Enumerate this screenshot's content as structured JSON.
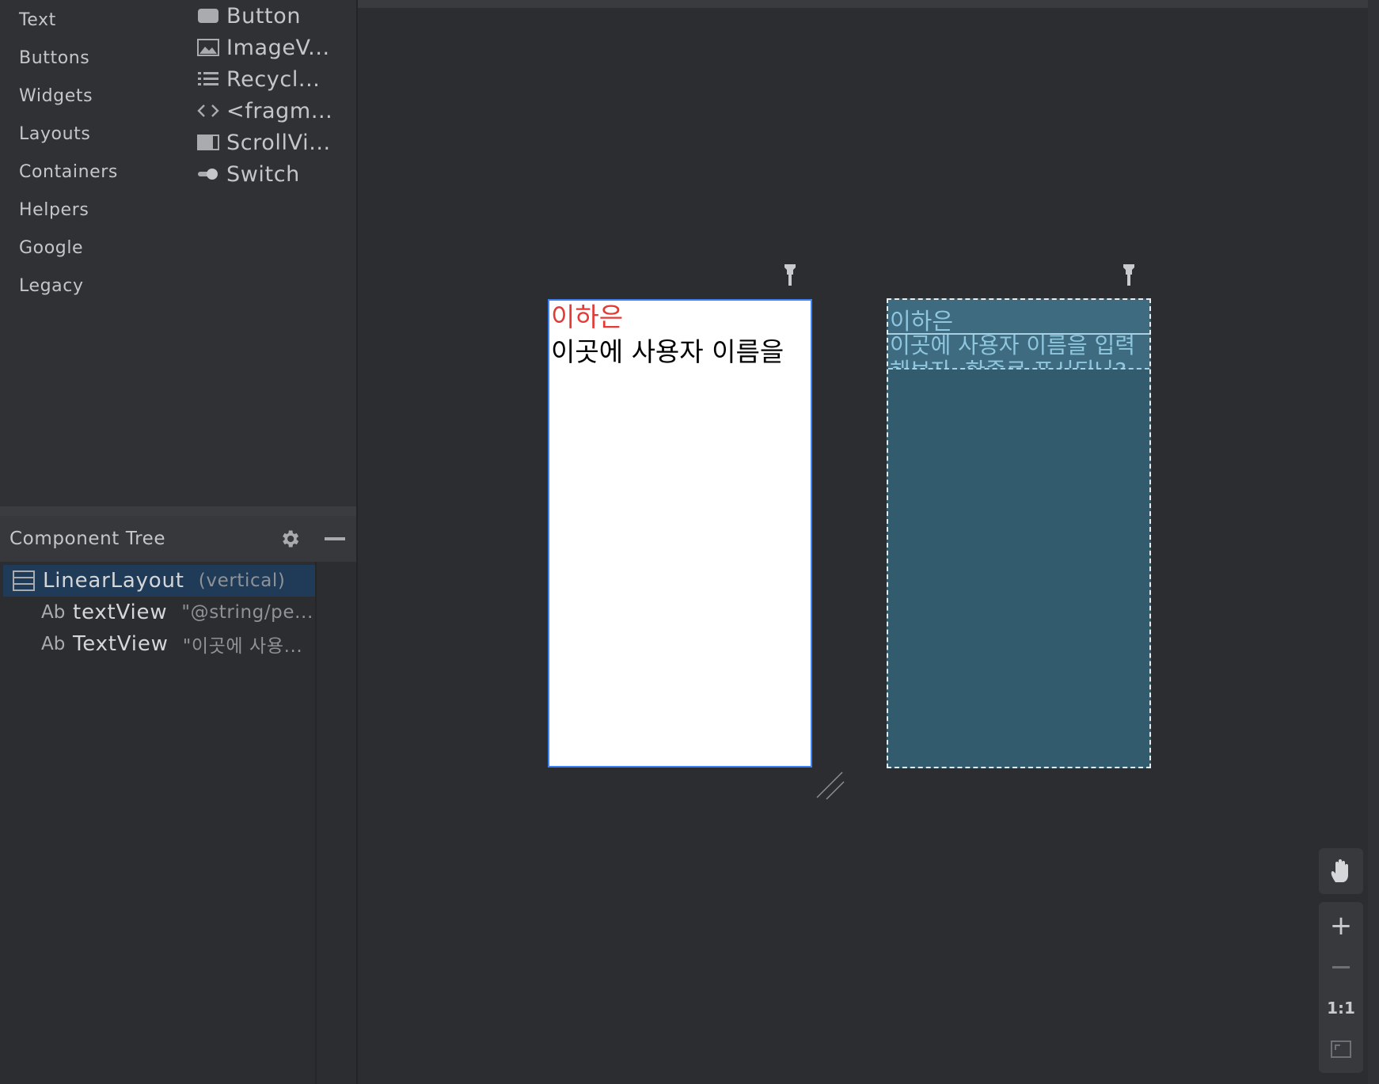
{
  "palette": {
    "categories": [
      "Text",
      "Buttons",
      "Widgets",
      "Layouts",
      "Containers",
      "Helpers",
      "Google",
      "Legacy"
    ],
    "widgets": [
      {
        "label": "Button",
        "icon": "button-icon"
      },
      {
        "label": "ImageV...",
        "icon": "image-icon"
      },
      {
        "label": "Recycl...",
        "icon": "list-icon"
      },
      {
        "label": "<fragm...",
        "icon": "code-icon"
      },
      {
        "label": "ScrollVi...",
        "icon": "scroll-icon"
      },
      {
        "label": "Switch",
        "icon": "switch-icon"
      }
    ]
  },
  "component_tree": {
    "title": "Component Tree",
    "rows": [
      {
        "name": "LinearLayout",
        "meta": "(vertical)",
        "icon": "linear-layout-icon"
      },
      {
        "prefix": "Ab",
        "name": "textView",
        "meta": "\"@string/pe..."
      },
      {
        "prefix": "Ab",
        "name": "TextView",
        "meta": "\"이곳에 사용..."
      }
    ]
  },
  "design": {
    "text1": "이하은",
    "text2": "이곳에 사용자 이름을",
    "text1_color": "#e53935"
  },
  "blueprint": {
    "text1": "이하은",
    "text2": "이곳에 사용자 이름을 입력해보자. 한줄로 표시되나?"
  },
  "zoom": {
    "in": "+",
    "one_to_one": "1:1"
  },
  "colors": {
    "selection": "#1f3b57",
    "design_border": "#3b82f6",
    "blueprint_bg": "#335b6e"
  }
}
